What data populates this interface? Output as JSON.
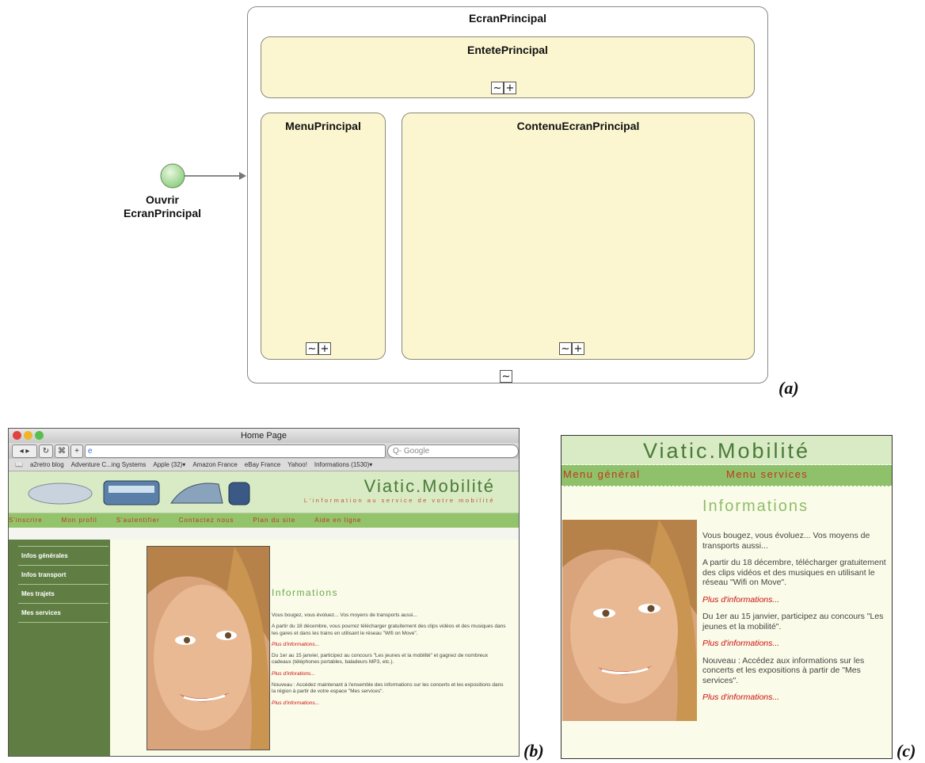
{
  "diagram": {
    "screen_title": "EcranPrincipal",
    "header_title": "EntetePrincipal",
    "menu_title": "MenuPrincipal",
    "content_title": "ContenuEcranPrincipal",
    "start_label_1": "Ouvrir",
    "start_label_2": "EcranPrincipal",
    "ctl_tilde": "~",
    "ctl_plus": "+",
    "panel_label": "(a)"
  },
  "browser": {
    "panel_label": "(b)",
    "window_title": "Home Page",
    "search_placeholder": "Q- Google",
    "bookmarks": [
      "a2retro blog",
      "Adventure C...ing Systems",
      "Apple (32)▾",
      "Amazon France",
      "eBay France",
      "Yahoo!",
      "Informations (1530)▾"
    ],
    "site_title": "Viatic.Mobilité",
    "site_subtitle": "L'information au service de votre mobilité",
    "top_menu": [
      "S'inscrire",
      "Mon profil",
      "S'autentifier",
      "Contactez nous",
      "Plan du site",
      "Aide en ligne"
    ],
    "side_menu": [
      "Infos générales",
      "Infos transport",
      "Mes trajets",
      "Mes services"
    ],
    "content_heading": "Informations",
    "paragraphs": [
      "Vous bougez, vous évoluez... Vos moyens de transports aussi...",
      "A partir du 18 décembre, vous pourrez télécharger gratuitement des clips vidéos et des musiques dans les gares et dans les trains en utilisant le réseau \"Wifi on Move\".",
      "Du 1er au 15 janvier, participez au concours \"Les jeunes et la mobilité\" et gagnez de nombreux cadeaux (téléphones portables, baladeurs MP3, etc.).",
      "Nouveau : Accédez maintenant à l'ensemble des informations sur les concerts et les expositions dans la région à partir de votre espace \"Mes services\"."
    ],
    "links": [
      "Plus d'informations...",
      "Plus d'inforations...",
      "Plus d'informations..."
    ]
  },
  "mobile": {
    "panel_label": "(c)",
    "site_title": "Viatic.Mobilité",
    "menu_general": "Menu général",
    "menu_services": "Menu services",
    "content_heading": "Informations",
    "paragraphs": [
      "Vous bougez, vous évoluez... Vos moyens de transports aussi...",
      "A partir du 18 décembre, télécharger gratuitement des clips vidéos et des musiques en utilisant le réseau \"Wifi on Move\".",
      "Du 1er au 15 janvier, participez au concours \"Les jeunes et la mobilité\".",
      "Nouveau : Accédez aux informations sur les concerts et les expositions à partir de \"Mes services\"."
    ],
    "link": "Plus d'informations..."
  },
  "colors": {
    "panel_fill": "#fbf6cf",
    "site_green": "#4a7a38",
    "menu_red": "#c0391b",
    "link_red": "#cc1010"
  }
}
